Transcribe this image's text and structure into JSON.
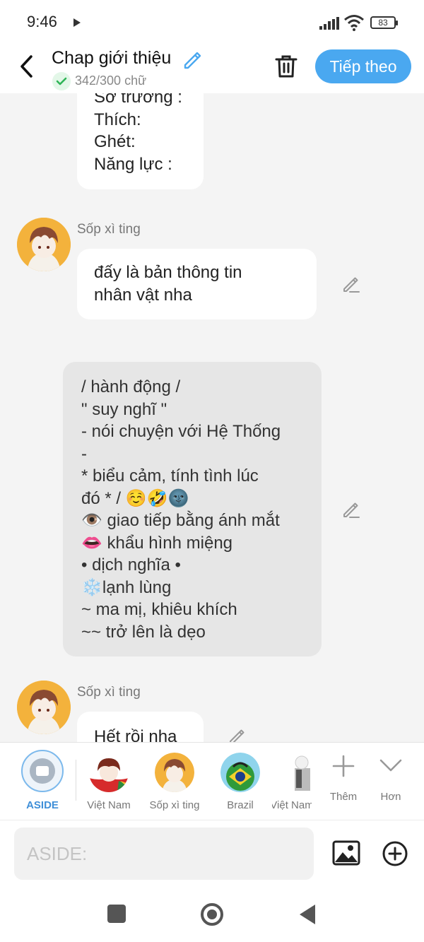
{
  "status": {
    "time": "9:46",
    "battery": "83"
  },
  "header": {
    "title": "Chap giới thiệu",
    "word_count": "342/300 chữ",
    "next_label": "Tiếp theo"
  },
  "messages": {
    "m1_text": "Sở trường :\nThích:\nGhét:\nNăng lực :",
    "m2_sender": "Sốp xì ting",
    "m2_text": "đấy là bản thông tin\nnhân vật nha",
    "m3_text": "/ hành động /\n\" suy nghĩ \"\n- nói chuyện với Hệ Thống\n-\n* biểu cảm, tính tình lúc\nđó * / ☺️🤣🌚\n👁️ giao tiếp bằng ánh mắt\n👄 khẩu hình miệng\n• dịch nghĩa •\n❄️lạnh lùng\n~ ma mị, khiêu khích\n~~ trở lên là dẹo",
    "m4_sender": "Sốp xì ting",
    "m4_text": "Hết rồi nha"
  },
  "characters": [
    {
      "name": "ASIDE"
    },
    {
      "name": "Việt Nam"
    },
    {
      "name": "Sốp xì ting"
    },
    {
      "name": "Brazil"
    },
    {
      "name": "Việt Nam"
    }
  ],
  "strip_actions": {
    "add_label": "Thêm",
    "more_label": "Hơn"
  },
  "input": {
    "placeholder": "ASIDE:"
  }
}
